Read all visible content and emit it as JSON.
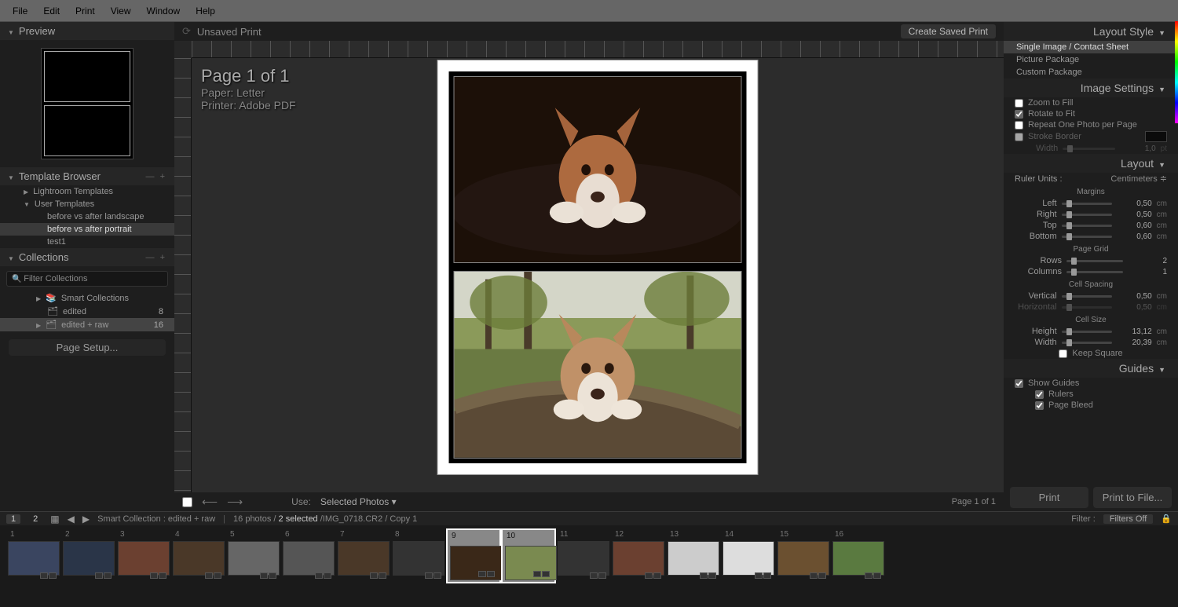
{
  "menu": {
    "file": "File",
    "edit": "Edit",
    "print": "Print",
    "view": "View",
    "window": "Window",
    "help": "Help"
  },
  "doc_title": "Unsaved Print",
  "create_saved": "Create Saved Print",
  "page_info": {
    "page": "Page 1 of 1",
    "paper": "Paper:  Letter",
    "printer": "Printer:  Adobe PDF"
  },
  "left": {
    "preview": "Preview",
    "template_browser": "Template Browser",
    "lightroom_templates": "Lightroom Templates",
    "user_templates": "User Templates",
    "tpl1": "before vs after landscape",
    "tpl2": "before vs after portrait",
    "tpl3": "test1",
    "collections": "Collections",
    "filter": "Filter Collections",
    "smart": "Smart Collections",
    "edited": "edited",
    "edited_count": "8",
    "edited_raw": "edited + raw",
    "edited_raw_count": "16"
  },
  "page_setup": "Page Setup...",
  "use": "Use:",
  "use_mode": "Selected Photos",
  "page_of": "Page 1 of 1",
  "right": {
    "layout_style": "Layout Style",
    "ls1": "Single Image / Contact Sheet",
    "ls2": "Picture Package",
    "ls3": "Custom Package",
    "image_settings": "Image Settings",
    "zoom_fill": "Zoom to Fill",
    "rotate_fit": "Rotate to Fit",
    "repeat": "Repeat One Photo per Page",
    "stroke": "Stroke Border",
    "stroke_width": "Width",
    "stroke_val": "1,0",
    "stroke_unit": "pt",
    "layout": "Layout",
    "ruler_units": "Ruler Units :",
    "ruler_val": "Centimeters",
    "margins": "Margins",
    "m_left": "Left",
    "m_left_v": "0,50",
    "m_right": "Right",
    "m_right_v": "0,50",
    "m_top": "Top",
    "m_top_v": "0,60",
    "m_bottom": "Bottom",
    "m_bottom_v": "0,60",
    "unit": "cm",
    "page_grid": "Page Grid",
    "rows": "Rows",
    "rows_v": "2",
    "cols": "Columns",
    "cols_v": "1",
    "cell_spacing": "Cell Spacing",
    "cs_v": "Vertical",
    "cs_v_v": "0,50",
    "cs_h": "Horizontal",
    "cs_h_v": "0,50",
    "cell_size": "Cell Size",
    "csz_h": "Height",
    "csz_h_v": "13,12",
    "csz_w": "Width",
    "csz_w_v": "20,39",
    "keep_sq": "Keep Square",
    "guides": "Guides",
    "show_guides": "Show Guides",
    "g_rulers": "Rulers",
    "g_bleed": "Page Bleed"
  },
  "print": "Print",
  "print_file": "Print to File...",
  "filmstrip": {
    "n1": "1",
    "n2": "2",
    "path": "Smart Collection : edited + raw",
    "count": "16 photos /",
    "sel": "2 selected",
    "file": "/IMG_0718.CR2 / Copy 1",
    "filter": "Filter :",
    "filter_v": "Filters Off",
    "thumbs": [
      "1",
      "2",
      "3",
      "4",
      "5",
      "6",
      "7",
      "8",
      "9",
      "10",
      "11",
      "12",
      "13",
      "14",
      "15",
      "16"
    ]
  }
}
